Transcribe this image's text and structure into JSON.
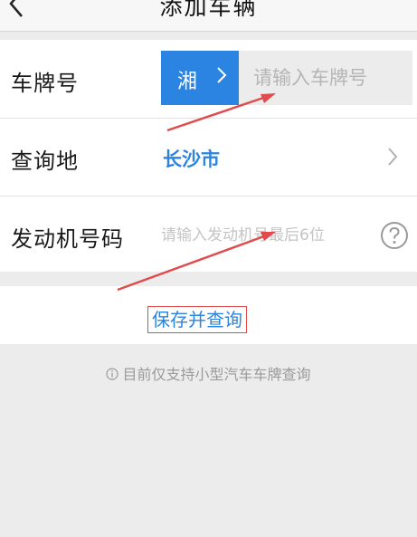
{
  "header": {
    "title": "添加车辆",
    "back_icon": "chevron-left-icon"
  },
  "form": {
    "plate": {
      "label": "车牌号",
      "province": "湘",
      "placeholder": "请输入车牌号"
    },
    "location": {
      "label": "查询地",
      "value": "长沙市"
    },
    "engine": {
      "label": "发动机号码",
      "placeholder": "请输入发动机号最后6位"
    }
  },
  "actions": {
    "save_label": "保存并查询"
  },
  "notice": {
    "text": "目前仅支持小型汽车车牌查询"
  },
  "colors": {
    "accent": "#2b83e2",
    "annotation": "#e24b4b"
  }
}
